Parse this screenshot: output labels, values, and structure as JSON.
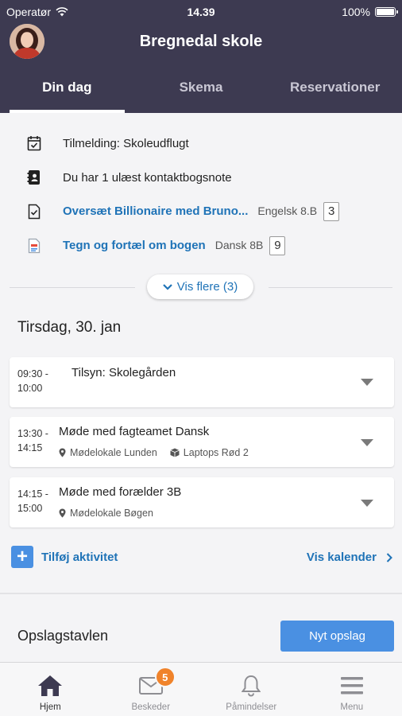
{
  "status_bar": {
    "carrier": "Operatør",
    "time": "14.39",
    "battery": "100%"
  },
  "header": {
    "title": "Bregnedal skole",
    "tabs": [
      {
        "label": "Din dag",
        "active": true
      },
      {
        "label": "Skema",
        "active": false
      },
      {
        "label": "Reservationer",
        "active": false
      }
    ]
  },
  "notifications": [
    {
      "icon": "calendar-check-icon",
      "text": "Tilmelding: Skoleudflugt",
      "link": false
    },
    {
      "icon": "contact-book-icon",
      "text": "Du har 1 ulæst kontaktbogsnote",
      "link": false
    },
    {
      "icon": "assignment-check-icon",
      "text": "Oversæt Billionaire med Bruno...",
      "link": true,
      "meta": "Engelsk 8.B",
      "count": "3"
    },
    {
      "icon": "document-icon",
      "text": "Tegn og fortæl om bogen",
      "link": true,
      "meta": "Dansk 8B",
      "count": "9"
    }
  ],
  "show_more": {
    "label": "Vis flere (3)"
  },
  "date_heading": "Tirsdag, 30. jan",
  "events": [
    {
      "time_start": "09:30 -",
      "time_end": "10:00",
      "title": "Tilsyn: Skolegården",
      "location": "",
      "resource": ""
    },
    {
      "time_start": "13:30 -",
      "time_end": "14:15",
      "title": "Møde med fagteamet Dansk",
      "location": "Mødelokale Lunden",
      "resource": "Laptops Rød 2"
    },
    {
      "time_start": "14:15 -",
      "time_end": "15:00",
      "title": "Møde med forælder 3B",
      "location": "Mødelokale Bøgen",
      "resource": ""
    }
  ],
  "actions": {
    "add_activity": "Tilføj aktivitet",
    "show_calendar": "Vis kalender"
  },
  "bulletin": {
    "title": "Opslagstavlen",
    "new_post": "Nyt opslag"
  },
  "bottom_nav": [
    {
      "label": "Hjem",
      "icon": "home-icon",
      "active": true
    },
    {
      "label": "Beskeder",
      "icon": "mail-icon",
      "badge": "5"
    },
    {
      "label": "Påmindelser",
      "icon": "bell-icon"
    },
    {
      "label": "Menu",
      "icon": "menu-icon"
    }
  ],
  "colors": {
    "header_bg": "#3d3a51",
    "link_blue": "#1f73b7",
    "button_blue": "#4a90e2",
    "badge_orange": "#f0832b"
  }
}
